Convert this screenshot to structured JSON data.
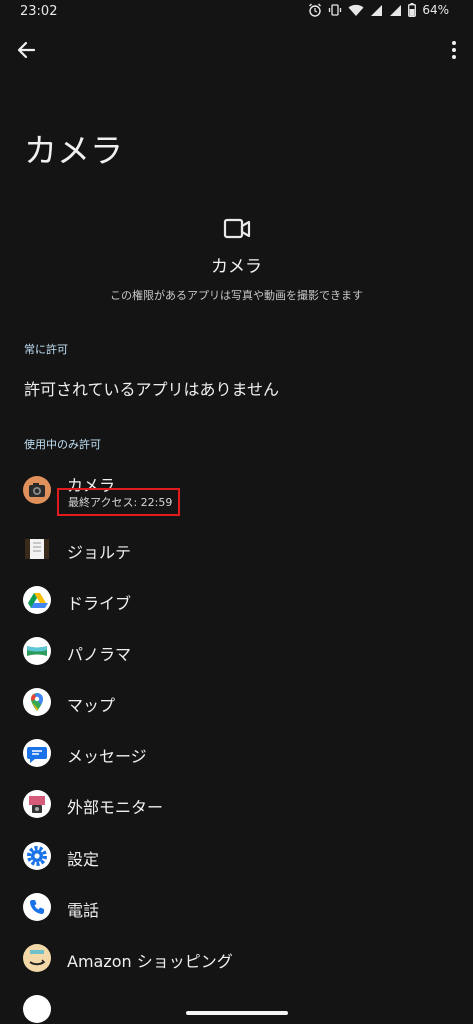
{
  "status_bar": {
    "time": "23:02",
    "battery": "64%",
    "icons": [
      "alarm-icon",
      "vibrate-icon",
      "wifi-icon",
      "signal-icon",
      "signal-icon",
      "battery-icon"
    ]
  },
  "toolbar": {
    "back_icon": "arrow-back-icon",
    "more_icon": "more-vert-icon"
  },
  "page": {
    "title": "カメラ"
  },
  "header": {
    "icon": "videocam-icon",
    "label": "カメラ",
    "description": "この権限があるアプリは写真や動画を撮影できます"
  },
  "sections": {
    "always": {
      "label": "常に許可",
      "empty_text": "許可されているアプリはありません"
    },
    "while_using": {
      "label": "使用中のみ許可"
    }
  },
  "apps": [
    {
      "name": "カメラ",
      "subtitle": "最終アクセス: 22:59",
      "icon": "camera-app-icon"
    },
    {
      "name": "ジョルテ",
      "icon": "jorte-icon"
    },
    {
      "name": "ドライブ",
      "icon": "drive-icon"
    },
    {
      "name": "パノラマ",
      "icon": "panorama-icon"
    },
    {
      "name": "マップ",
      "icon": "maps-icon"
    },
    {
      "name": "メッセージ",
      "icon": "messages-icon"
    },
    {
      "name": "外部モニター",
      "icon": "external-monitor-icon"
    },
    {
      "name": "設定",
      "icon": "settings-icon"
    },
    {
      "name": "電話",
      "icon": "phone-icon"
    },
    {
      "name": "Amazon ショッピング",
      "icon": "amazon-icon"
    }
  ],
  "colors": {
    "background": "#141414",
    "section_label": "#bfe0f5",
    "highlight": "#e21c1c"
  }
}
